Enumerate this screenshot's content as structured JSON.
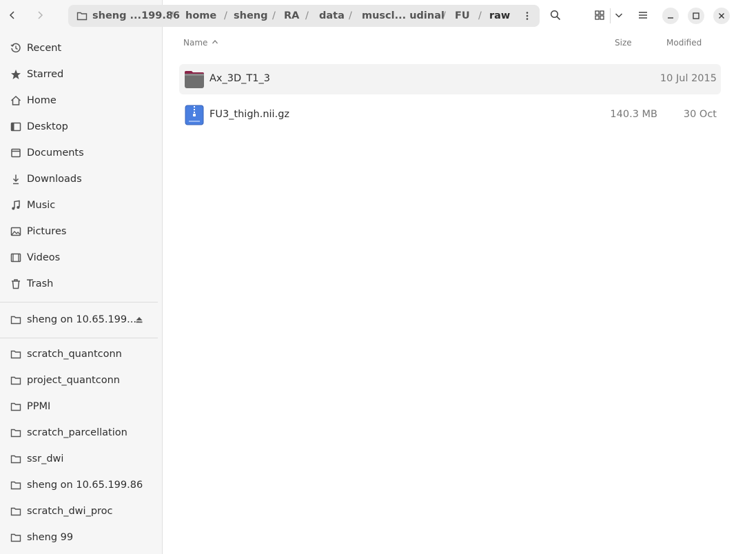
{
  "header": {
    "path": [
      "sheng ...199.86",
      "home",
      "sheng",
      "RA",
      "data",
      "muscl... udinal",
      "FU",
      "raw"
    ]
  },
  "sidebar": {
    "places": [
      {
        "label": "Recent",
        "icon": "clock-icon"
      },
      {
        "label": "Starred",
        "icon": "star-icon"
      },
      {
        "label": "Home",
        "icon": "home-icon"
      },
      {
        "label": "Desktop",
        "icon": "desktop-icon"
      },
      {
        "label": "Documents",
        "icon": "document-icon"
      },
      {
        "label": "Downloads",
        "icon": "download-icon"
      },
      {
        "label": "Music",
        "icon": "music-icon"
      },
      {
        "label": "Pictures",
        "icon": "picture-icon"
      },
      {
        "label": "Videos",
        "icon": "video-icon"
      },
      {
        "label": "Trash",
        "icon": "trash-icon"
      }
    ],
    "mounts": [
      {
        "label": "sheng on 10.65.199....",
        "icon": "network-folder-icon"
      }
    ],
    "bookmarks": [
      {
        "label": "scratch_quantconn"
      },
      {
        "label": "project_quantconn"
      },
      {
        "label": "PPMI"
      },
      {
        "label": "scratch_parcellation"
      },
      {
        "label": "ssr_dwi"
      },
      {
        "label": "sheng on 10.65.199.86"
      },
      {
        "label": "scratch_dwi_proc"
      },
      {
        "label": "sheng 99"
      }
    ]
  },
  "columns": {
    "name": "Name",
    "size": "Size",
    "modified": "Modified"
  },
  "files": [
    {
      "name": "Ax_3D_T1_3",
      "size": "",
      "modified": "10 Jul 2015",
      "icon": "folder-icon"
    },
    {
      "name": "FU3_thigh.nii.gz",
      "size": "140.3 MB",
      "modified": "30 Oct",
      "icon": "archive-icon"
    }
  ],
  "colors": {
    "accent": "#e95420",
    "sidebar_bg": "#f6f6f6",
    "selected_row": "#f3f3f3"
  }
}
